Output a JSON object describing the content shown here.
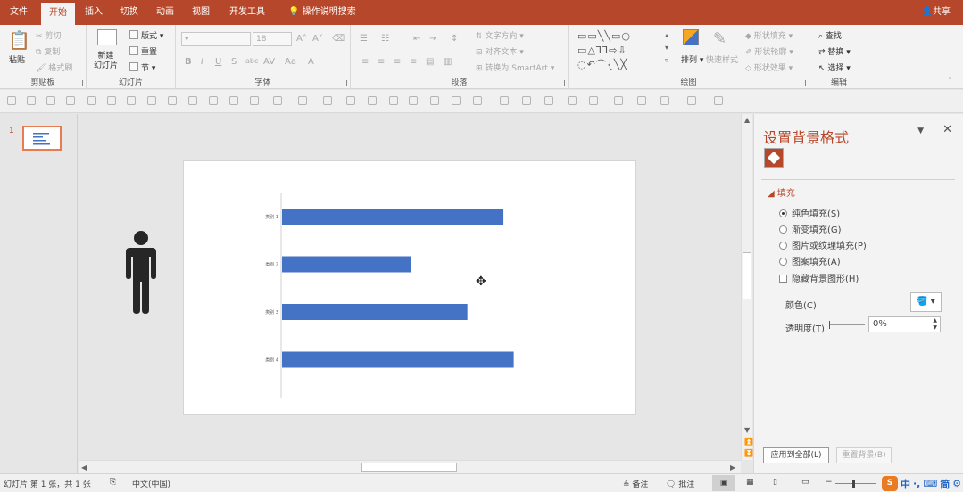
{
  "tabs": [
    {
      "label": "文件",
      "active": false
    },
    {
      "label": "开始",
      "active": true
    },
    {
      "label": "插入",
      "active": false
    },
    {
      "label": "切换",
      "active": false
    },
    {
      "label": "动画",
      "active": false
    },
    {
      "label": "视图",
      "active": false
    },
    {
      "label": "开发工具",
      "active": false
    }
  ],
  "tell_me": "操作说明搜索",
  "share": "共享",
  "ribbon": {
    "clipboard": {
      "label": "剪贴板",
      "paste": "粘贴",
      "cut": "剪切",
      "copy": "复制",
      "format_painter": "格式刷"
    },
    "slides": {
      "label": "幻灯片",
      "new_slide": "新建\n幻灯片",
      "layout": "版式",
      "reset": "重置",
      "section": "节"
    },
    "font": {
      "label": "字体",
      "size": "18"
    },
    "paragraph": {
      "label": "段落",
      "text_direction": "文字方向",
      "align_text": "对齐文本",
      "convert_smartart": "转换为 SmartArt"
    },
    "drawing": {
      "label": "绘图",
      "arrange": "排列",
      "quick_styles": "快速样式",
      "shape_fill": "形状填充",
      "shape_outline": "形状轮廓",
      "shape_effects": "形状效果"
    },
    "editing": {
      "label": "编辑",
      "find": "查找",
      "replace": "替换",
      "select": "选择"
    }
  },
  "thumbnail": {
    "number": "1"
  },
  "chart_data": {
    "type": "bar",
    "orientation": "horizontal",
    "categories": [
      "类别 1",
      "类别 2",
      "类别 3",
      "类别 4"
    ],
    "values": [
      4.3,
      2.5,
      3.6,
      4.5
    ],
    "xlim": [
      0,
      5.2
    ],
    "bar_color": "#4472c4"
  },
  "pane": {
    "title": "设置背景格式",
    "section": "填充",
    "options": [
      {
        "label": "纯色填充(S)",
        "checked": true
      },
      {
        "label": "渐变填充(G)",
        "checked": false
      },
      {
        "label": "图片或纹理填充(P)",
        "checked": false
      },
      {
        "label": "图案填充(A)",
        "checked": false
      }
    ],
    "hide_bg_graphics": "隐藏背景图形(H)",
    "color_label": "颜色(C)",
    "transparency_label": "透明度(T)",
    "transparency_value": "0%",
    "apply_all": "应用到全部(L)",
    "reset_bg": "重置背景(B)"
  },
  "status": {
    "slide_info": "幻灯片 第 1 张，共 1 张",
    "language": "中文(中国)",
    "notes": "备注",
    "comments": "批注"
  },
  "ime": {
    "lang": "中",
    "simplified": "简",
    "logo": "S"
  },
  "colors": {
    "accent": "#b7472a",
    "chart_bar": "#4472c4",
    "person": "#262626"
  }
}
